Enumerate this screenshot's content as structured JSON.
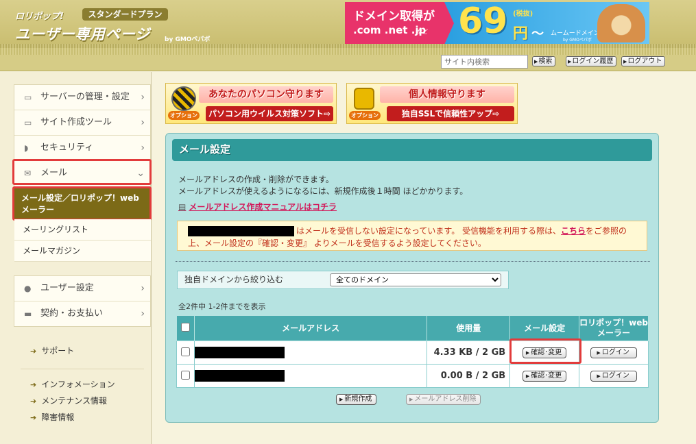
{
  "header": {
    "logo_line1": "ロリポップ!",
    "plan_badge": "スタンダードプラン",
    "logo_line2": "ユーザー専用ページ",
    "logo_by": "by GMOペパボ",
    "banner": {
      "line1": "ドメイン取得が",
      "line2": ".com .net .jp",
      "line2_suffix": "など",
      "price": "69",
      "tax": "(税抜)",
      "yen": "円",
      "wave": "〜",
      "brand": "ムームードメイン",
      "brand_by": "by GMOペパボ"
    }
  },
  "toolbar": {
    "search_placeholder": "サイト内検索",
    "search_button": "検索",
    "login_history": "ログイン履歴",
    "logout": "ログアウト"
  },
  "sidebar": {
    "items": [
      {
        "label": "サーバーの管理・設定",
        "icon": "server-icon"
      },
      {
        "label": "サイト作成ツール",
        "icon": "laptop-icon"
      },
      {
        "label": "セキュリティ",
        "icon": "shield-icon"
      },
      {
        "label": "メール",
        "icon": "envelope-icon"
      }
    ],
    "mail_sub": {
      "selected": "メール設定／ロリポップ！webメーラー",
      "mailing_list": "メーリングリスト",
      "mail_magazine": "メールマガジン"
    },
    "items2": [
      {
        "label": "ユーザー設定",
        "icon": "user-icon"
      },
      {
        "label": "契約・お支払い",
        "icon": "credit-card-icon"
      }
    ],
    "links": {
      "support": "サポート",
      "information": "インフォメーション",
      "maintenance": "メンテナンス情報",
      "failure": "障害情報"
    }
  },
  "promos": [
    {
      "head": "あなたのパソコン守ります",
      "sub": "パソコン用ウイルス対策ソフト⇨",
      "option": "オプション"
    },
    {
      "head": "個人情報守ります",
      "sub": "独自SSLで信頼性アップ⇨",
      "option": "オプション"
    }
  ],
  "panel": {
    "title": "メール設定",
    "desc1": "メールアドレスの作成・削除ができます。",
    "desc2": "メールアドレスが使えるようになるには、新規作成後１時間 ほどかかります。",
    "manual_link": "メールアドレス作成マニュアルはコチラ",
    "warning_part1": "はメールを受信しない設定になっています。 受信機能を利用する際は、",
    "warning_link": "こちら",
    "warning_part2": "をご参照の",
    "warning_line2": "上、メール設定の『確認・変更』 よりメールを受信するよう設定してください。",
    "filter_label": "独自ドメインから絞り込む",
    "filter_selected": "全てのドメイン",
    "count_text": "全2件中 1-2件までを表示",
    "table": {
      "headers": {
        "address": "メールアドレス",
        "usage": "使用量",
        "settings": "メール設定",
        "webmailer": "ロリポップ！webメーラー"
      },
      "rows": [
        {
          "usage": "4.33 KB / 2 GB",
          "settings_btn": "確認･変更",
          "login_btn": "ログイン"
        },
        {
          "usage": "0.00 B / 2 GB",
          "settings_btn": "確認･変更",
          "login_btn": "ログイン"
        }
      ]
    },
    "new_button": "新規作成",
    "delete_button": "メールアドレス削除"
  }
}
